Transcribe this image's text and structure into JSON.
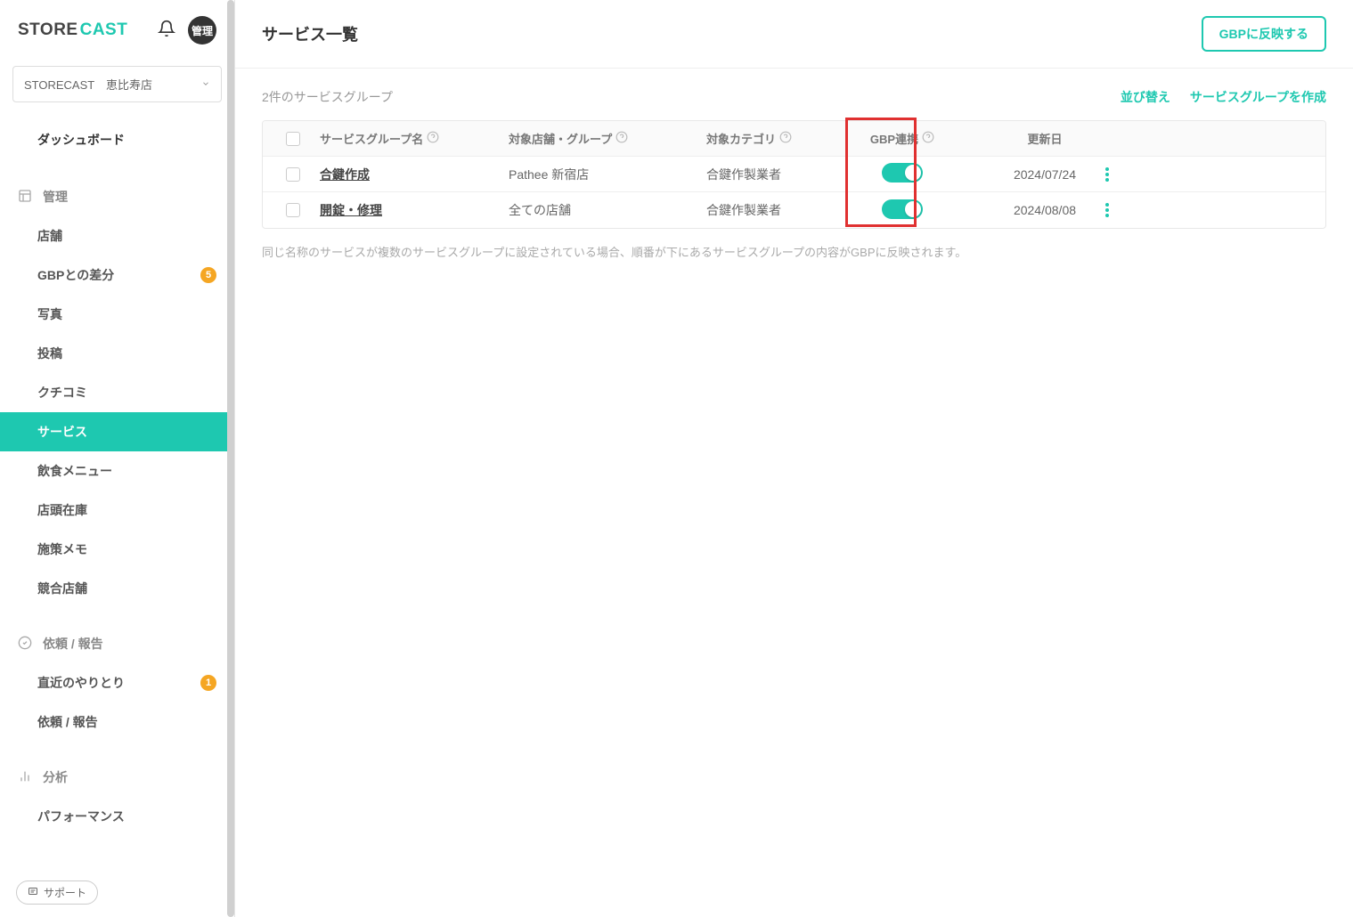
{
  "logo": {
    "part1": "STORE",
    "part2": "CAST"
  },
  "header": {
    "admin_label": "管理"
  },
  "store_select": {
    "label": "STORECAST　恵比寿店"
  },
  "sidebar": {
    "dashboard": "ダッシュボード",
    "sections": [
      {
        "label": "管理",
        "items": [
          {
            "label": "店舗",
            "badge": null,
            "active": false
          },
          {
            "label": "GBPとの差分",
            "badge": "5",
            "active": false
          },
          {
            "label": "写真",
            "badge": null,
            "active": false
          },
          {
            "label": "投稿",
            "badge": null,
            "active": false
          },
          {
            "label": "クチコミ",
            "badge": null,
            "active": false
          },
          {
            "label": "サービス",
            "badge": null,
            "active": true
          },
          {
            "label": "飲食メニュー",
            "badge": null,
            "active": false
          },
          {
            "label": "店頭在庫",
            "badge": null,
            "active": false
          },
          {
            "label": "施策メモ",
            "badge": null,
            "active": false
          },
          {
            "label": "競合店舗",
            "badge": null,
            "active": false
          }
        ]
      },
      {
        "label": "依頼 / 報告",
        "items": [
          {
            "label": "直近のやりとり",
            "badge": "1",
            "active": false
          },
          {
            "label": "依頼 / 報告",
            "badge": null,
            "active": false
          }
        ]
      },
      {
        "label": "分析",
        "items": [
          {
            "label": "パフォーマンス",
            "badge": null,
            "active": false
          }
        ]
      }
    ],
    "support": "サポート"
  },
  "main": {
    "title": "サービス一覧",
    "gbp_button": "GBPに反映する",
    "count_text": "2件のサービスグループ",
    "sort_action": "並び替え",
    "create_action": "サービスグループを作成",
    "columns": {
      "name": "サービスグループ名",
      "store": "対象店舗・グループ",
      "category": "対象カテゴリ",
      "gbp": "GBP連携",
      "date": "更新日"
    },
    "rows": [
      {
        "name": "合鍵作成",
        "store": "Pathee 新宿店",
        "category": "合鍵作製業者",
        "gbp_linked": true,
        "date": "2024/07/24"
      },
      {
        "name": "開錠・修理",
        "store": "全ての店舗",
        "category": "合鍵作製業者",
        "gbp_linked": true,
        "date": "2024/08/08"
      }
    ],
    "note": "同じ名称のサービスが複数のサービスグループに設定されている場合、順番が下にあるサービスグループの内容がGBPに反映されます。"
  }
}
